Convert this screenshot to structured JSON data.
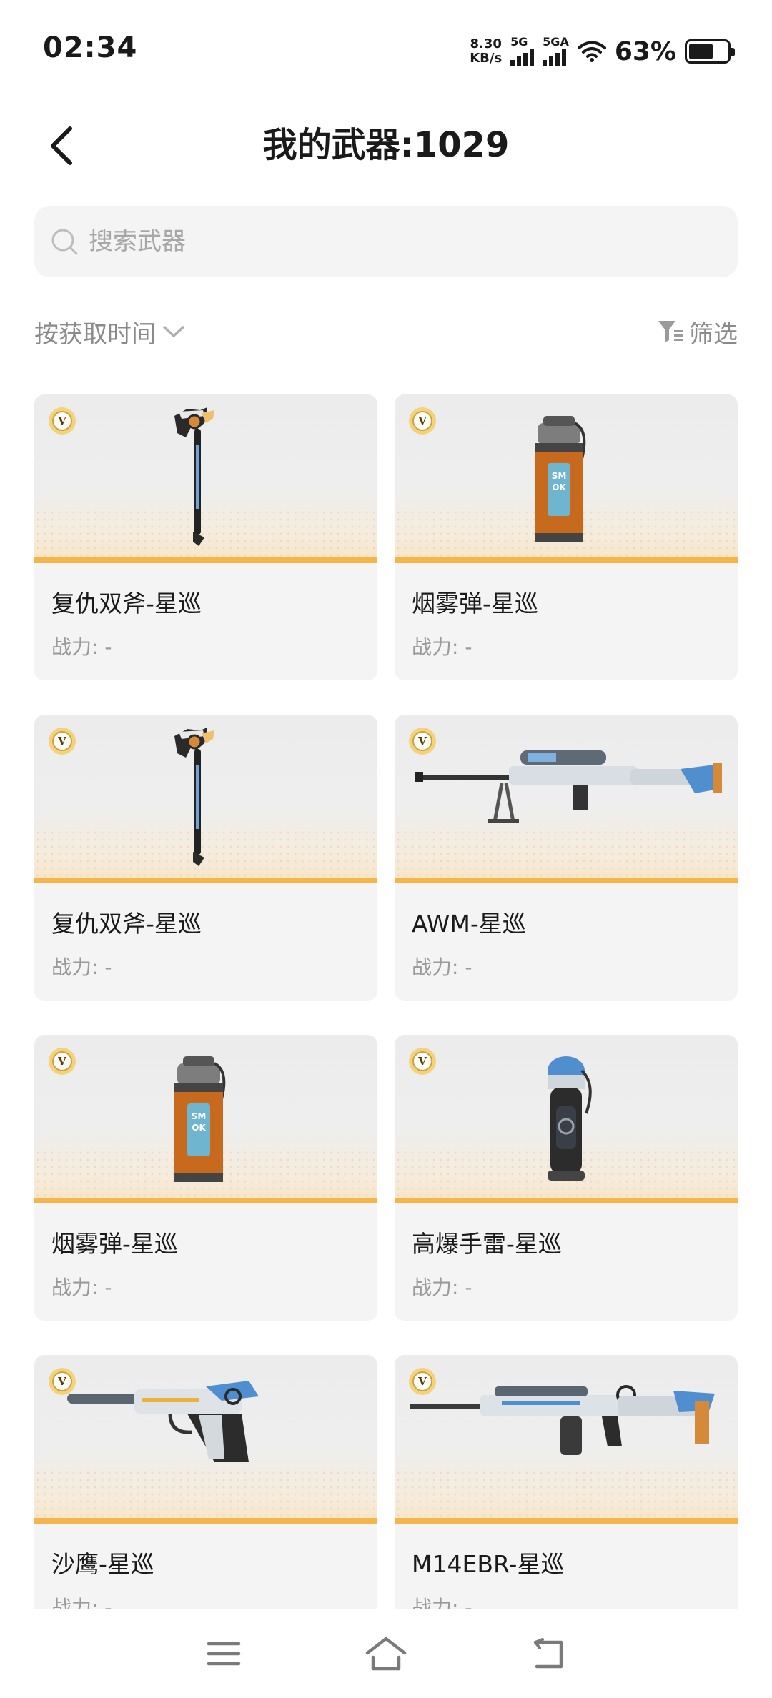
{
  "status_bar": {
    "time": "02:34",
    "net_speed_value": "8.30",
    "net_speed_unit": "KB/s",
    "sim1_label": "5G",
    "sim2_label": "5GA",
    "battery_percent": "63%",
    "battery_level": 0.63
  },
  "header": {
    "title": "我的武器:1029",
    "back_icon": "chevron-left-icon"
  },
  "search": {
    "placeholder": "搜索武器",
    "value": "",
    "icon": "search-icon"
  },
  "toolbar": {
    "sort_label": "按获取时间",
    "sort_icon": "chevron-down-icon",
    "filter_label": "筛选",
    "filter_icon": "filter-icon"
  },
  "colors": {
    "accent_bar": "#f5b54a",
    "card_background": "#f4f4f4",
    "secondary_text": "#8a8a8a"
  },
  "weapons": [
    {
      "name": "复仇双斧-星巡",
      "power": "战力: -",
      "badge": "V",
      "image": "axe-icon"
    },
    {
      "name": "烟雾弹-星巡",
      "power": "战力: -",
      "badge": "V",
      "image": "smoke-grenade-icon"
    },
    {
      "name": "复仇双斧-星巡",
      "power": "战力: -",
      "badge": "V",
      "image": "axe-icon"
    },
    {
      "name": "AWM-星巡",
      "power": "战力: -",
      "badge": "V",
      "image": "sniper-rifle-icon"
    },
    {
      "name": "烟雾弹-星巡",
      "power": "战力: -",
      "badge": "V",
      "image": "smoke-grenade-icon"
    },
    {
      "name": "高爆手雷-星巡",
      "power": "战力: -",
      "badge": "V",
      "image": "frag-grenade-icon"
    },
    {
      "name": "沙鹰-星巡",
      "power": "战力: -",
      "badge": "V",
      "image": "pistol-icon"
    },
    {
      "name": "M14EBR-星巡",
      "power": "战力: -",
      "badge": "V",
      "image": "rifle-icon"
    }
  ],
  "nav": {
    "menu_icon": "menu-icon",
    "home_icon": "home-icon",
    "back_icon": "back-icon"
  }
}
